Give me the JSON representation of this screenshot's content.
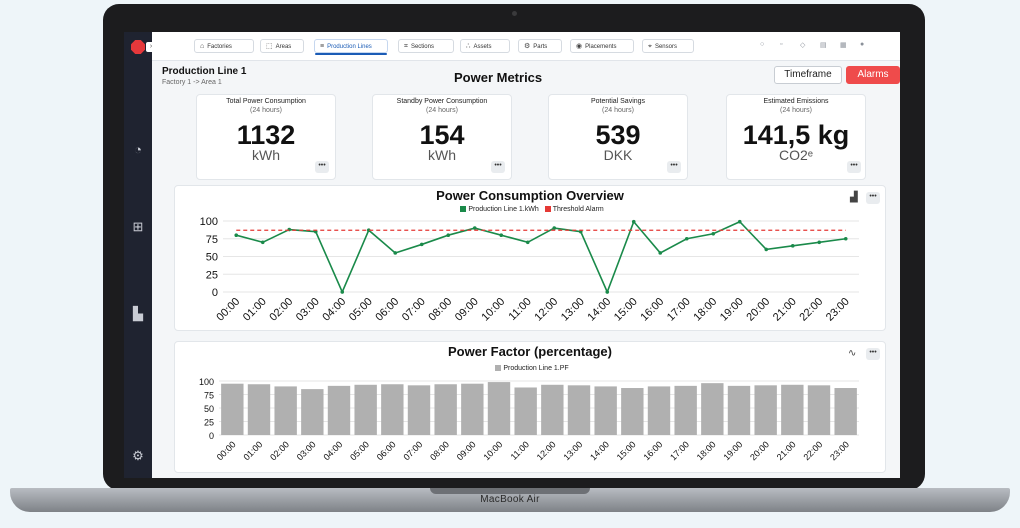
{
  "device": {
    "brand": "MacBook Air"
  },
  "topbar": {
    "tabs": [
      {
        "label": "Factories",
        "icon": "factory-icon",
        "glyph": "⌂"
      },
      {
        "label": "Areas",
        "icon": "area-icon",
        "glyph": "⬚"
      },
      {
        "label": "Production Lines",
        "icon": "production-line-icon",
        "glyph": "≡"
      },
      {
        "label": "Sections",
        "icon": "section-icon",
        "glyph": "⌗"
      },
      {
        "label": "Assets",
        "icon": "assets-icon",
        "glyph": "∴"
      },
      {
        "label": "Parts",
        "icon": "parts-icon",
        "glyph": "⚙"
      },
      {
        "label": "Placements",
        "icon": "placement-icon",
        "glyph": "◉"
      },
      {
        "label": "Sensors",
        "icon": "sensor-icon",
        "glyph": "⌖"
      }
    ],
    "active_tab": "Production Lines"
  },
  "header": {
    "title": "Production Line 1",
    "breadcrumb": "Factory 1 -> Area 1",
    "section_title": "Power Metrics",
    "timeframe_label": "Timeframe",
    "alarms_label": "Alarms"
  },
  "cards": [
    {
      "title": "Total Power Consumption",
      "subtitle": "(24 hours)",
      "value": "1132",
      "unit": "kWh"
    },
    {
      "title": "Standby Power Consumption",
      "subtitle": "(24 hours)",
      "value": "154",
      "unit": "kWh"
    },
    {
      "title": "Potential Savings",
      "subtitle": "(24 hours)",
      "value": "539",
      "unit": "DKK"
    },
    {
      "title": "Estimated Emissions",
      "subtitle": "(24 hours)",
      "value": "141,5 kg",
      "unit": "CO2ᵉ"
    }
  ],
  "more_label": "•••",
  "colors": {
    "accent": "#1b5cb6",
    "alarm": "#ef4b4b",
    "line": "#1a8a4a",
    "threshold": "#e53935",
    "bar": "#b0b0b0"
  },
  "chart_data": [
    {
      "type": "line",
      "title": "Power Consumption Overview",
      "series": [
        {
          "name": "Production Line 1.kWh",
          "color": "#1a8a4a",
          "values": [
            80,
            70,
            88,
            85,
            0,
            87,
            55,
            67,
            80,
            90,
            80,
            70,
            90,
            85,
            0,
            99,
            55,
            75,
            82,
            99,
            60,
            65,
            70,
            75
          ]
        },
        {
          "name": "Threshold Alarm",
          "color": "#e53935",
          "values": [
            87,
            87,
            87,
            87,
            87,
            87,
            87,
            87,
            87,
            87,
            87,
            87,
            87,
            87,
            87,
            87,
            87,
            87,
            87,
            87,
            87,
            87,
            87,
            87
          ]
        }
      ],
      "categories": [
        "00:00",
        "01:00",
        "02:00",
        "03:00",
        "04:00",
        "05:00",
        "06:00",
        "07:00",
        "08:00",
        "09:00",
        "10:00",
        "11:00",
        "12:00",
        "13:00",
        "14:00",
        "15:00",
        "16:00",
        "17:00",
        "18:00",
        "19:00",
        "20:00",
        "21:00",
        "22:00",
        "23:00"
      ],
      "yticks": [
        0,
        25,
        50,
        75,
        100
      ],
      "ylim": [
        0,
        100
      ],
      "grid": true,
      "legend": "top-center"
    },
    {
      "type": "bar",
      "title": "Power Factor (percentage)",
      "series": [
        {
          "name": "Production Line 1.PF",
          "color": "#b0b0b0",
          "values": [
            95,
            94,
            90,
            85,
            91,
            93,
            94,
            92,
            94,
            95,
            98,
            88,
            93,
            92,
            90,
            87,
            90,
            91,
            96,
            91,
            92,
            93,
            92,
            87
          ]
        }
      ],
      "categories": [
        "00:00",
        "01:00",
        "02:00",
        "03:00",
        "04:00",
        "05:00",
        "06:00",
        "07:00",
        "08:00",
        "09:00",
        "10:00",
        "11:00",
        "12:00",
        "13:00",
        "14:00",
        "15:00",
        "16:00",
        "17:00",
        "18:00",
        "19:00",
        "20:00",
        "21:00",
        "22:00",
        "23:00"
      ],
      "yticks": [
        0,
        25,
        50,
        75,
        100
      ],
      "ylim": [
        0,
        100
      ],
      "grid": true,
      "legend": "top-center"
    }
  ]
}
